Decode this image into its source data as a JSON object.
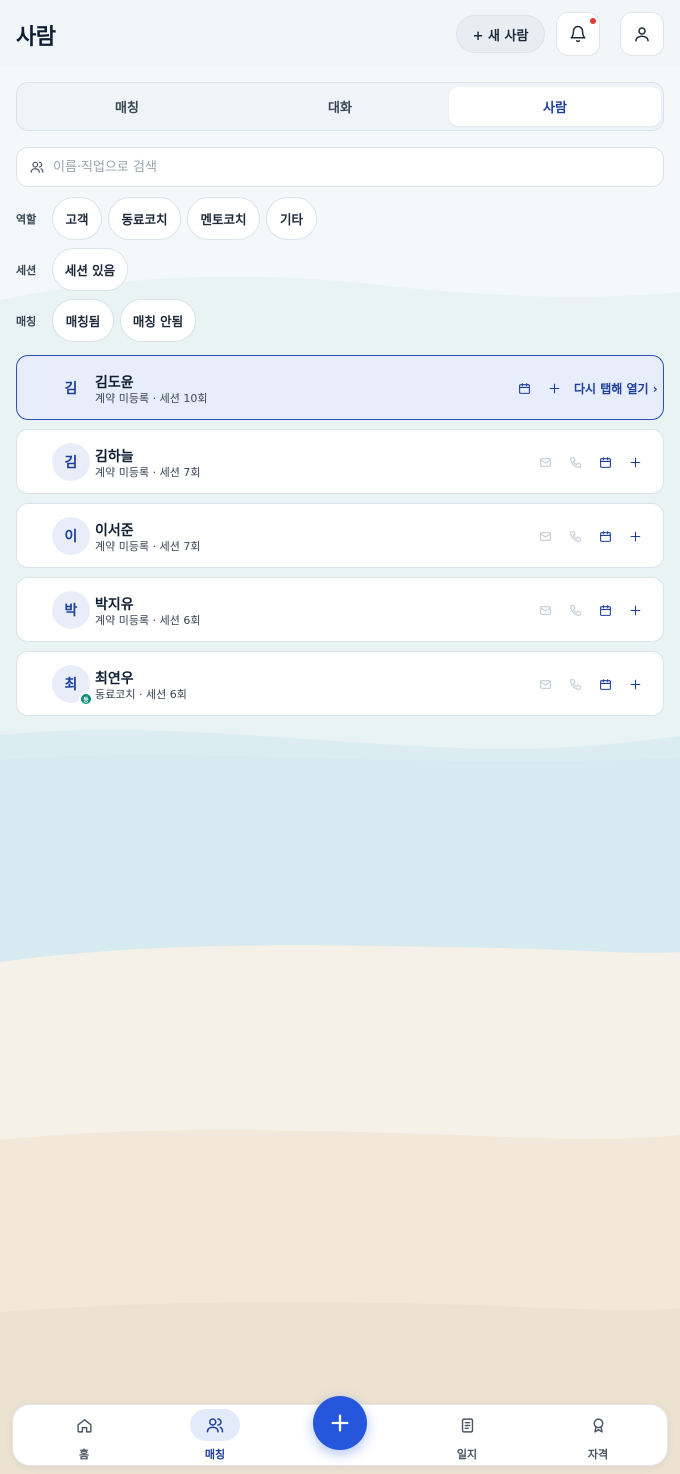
{
  "header": {
    "title": "사람",
    "new_person_label": "+ 새 사람",
    "has_notification": true
  },
  "tabs": [
    {
      "label": "매칭",
      "active": false
    },
    {
      "label": "대화",
      "active": false
    },
    {
      "label": "사람",
      "active": true
    }
  ],
  "search": {
    "placeholder": "이름·직업으로 검색",
    "value": ""
  },
  "filters": {
    "role": {
      "label": "역할",
      "options": [
        "고객",
        "동료코치",
        "멘토코치",
        "기타"
      ]
    },
    "session": {
      "label": "세션",
      "options": [
        "세션 있음"
      ]
    },
    "matching": {
      "label": "매칭",
      "options": [
        "매칭됨",
        "매칭 안됨"
      ]
    }
  },
  "people": [
    {
      "initial": "김",
      "name": "김도윤",
      "meta": "계약 미등록 · 세션 10회",
      "active": true,
      "reopen_label": "다시 탭해 열기 ›"
    },
    {
      "initial": "김",
      "name": "김하늘",
      "meta": "계약 미등록 · 세션 7회",
      "active": false
    },
    {
      "initial": "이",
      "name": "이서준",
      "meta": "계약 미등록 · 세션 7회",
      "active": false
    },
    {
      "initial": "박",
      "name": "박지유",
      "meta": "계약 미등록 · 세션 6회",
      "active": false
    },
    {
      "initial": "최",
      "name": "최연우",
      "meta": "동료코치 · 세션 6회",
      "active": false,
      "badge": "동"
    }
  ],
  "bottom_nav": [
    {
      "label": "홈",
      "icon": "home-icon",
      "active": false
    },
    {
      "label": "매칭",
      "icon": "people-icon",
      "active": true
    },
    {
      "label": "일지",
      "icon": "journal-icon",
      "active": false
    },
    {
      "label": "자격",
      "icon": "award-icon",
      "active": false
    }
  ],
  "colors": {
    "accent": "#1d3f9a",
    "fab": "#2556dc",
    "notification": "#e53935",
    "peer_badge": "#0c8a7a"
  }
}
